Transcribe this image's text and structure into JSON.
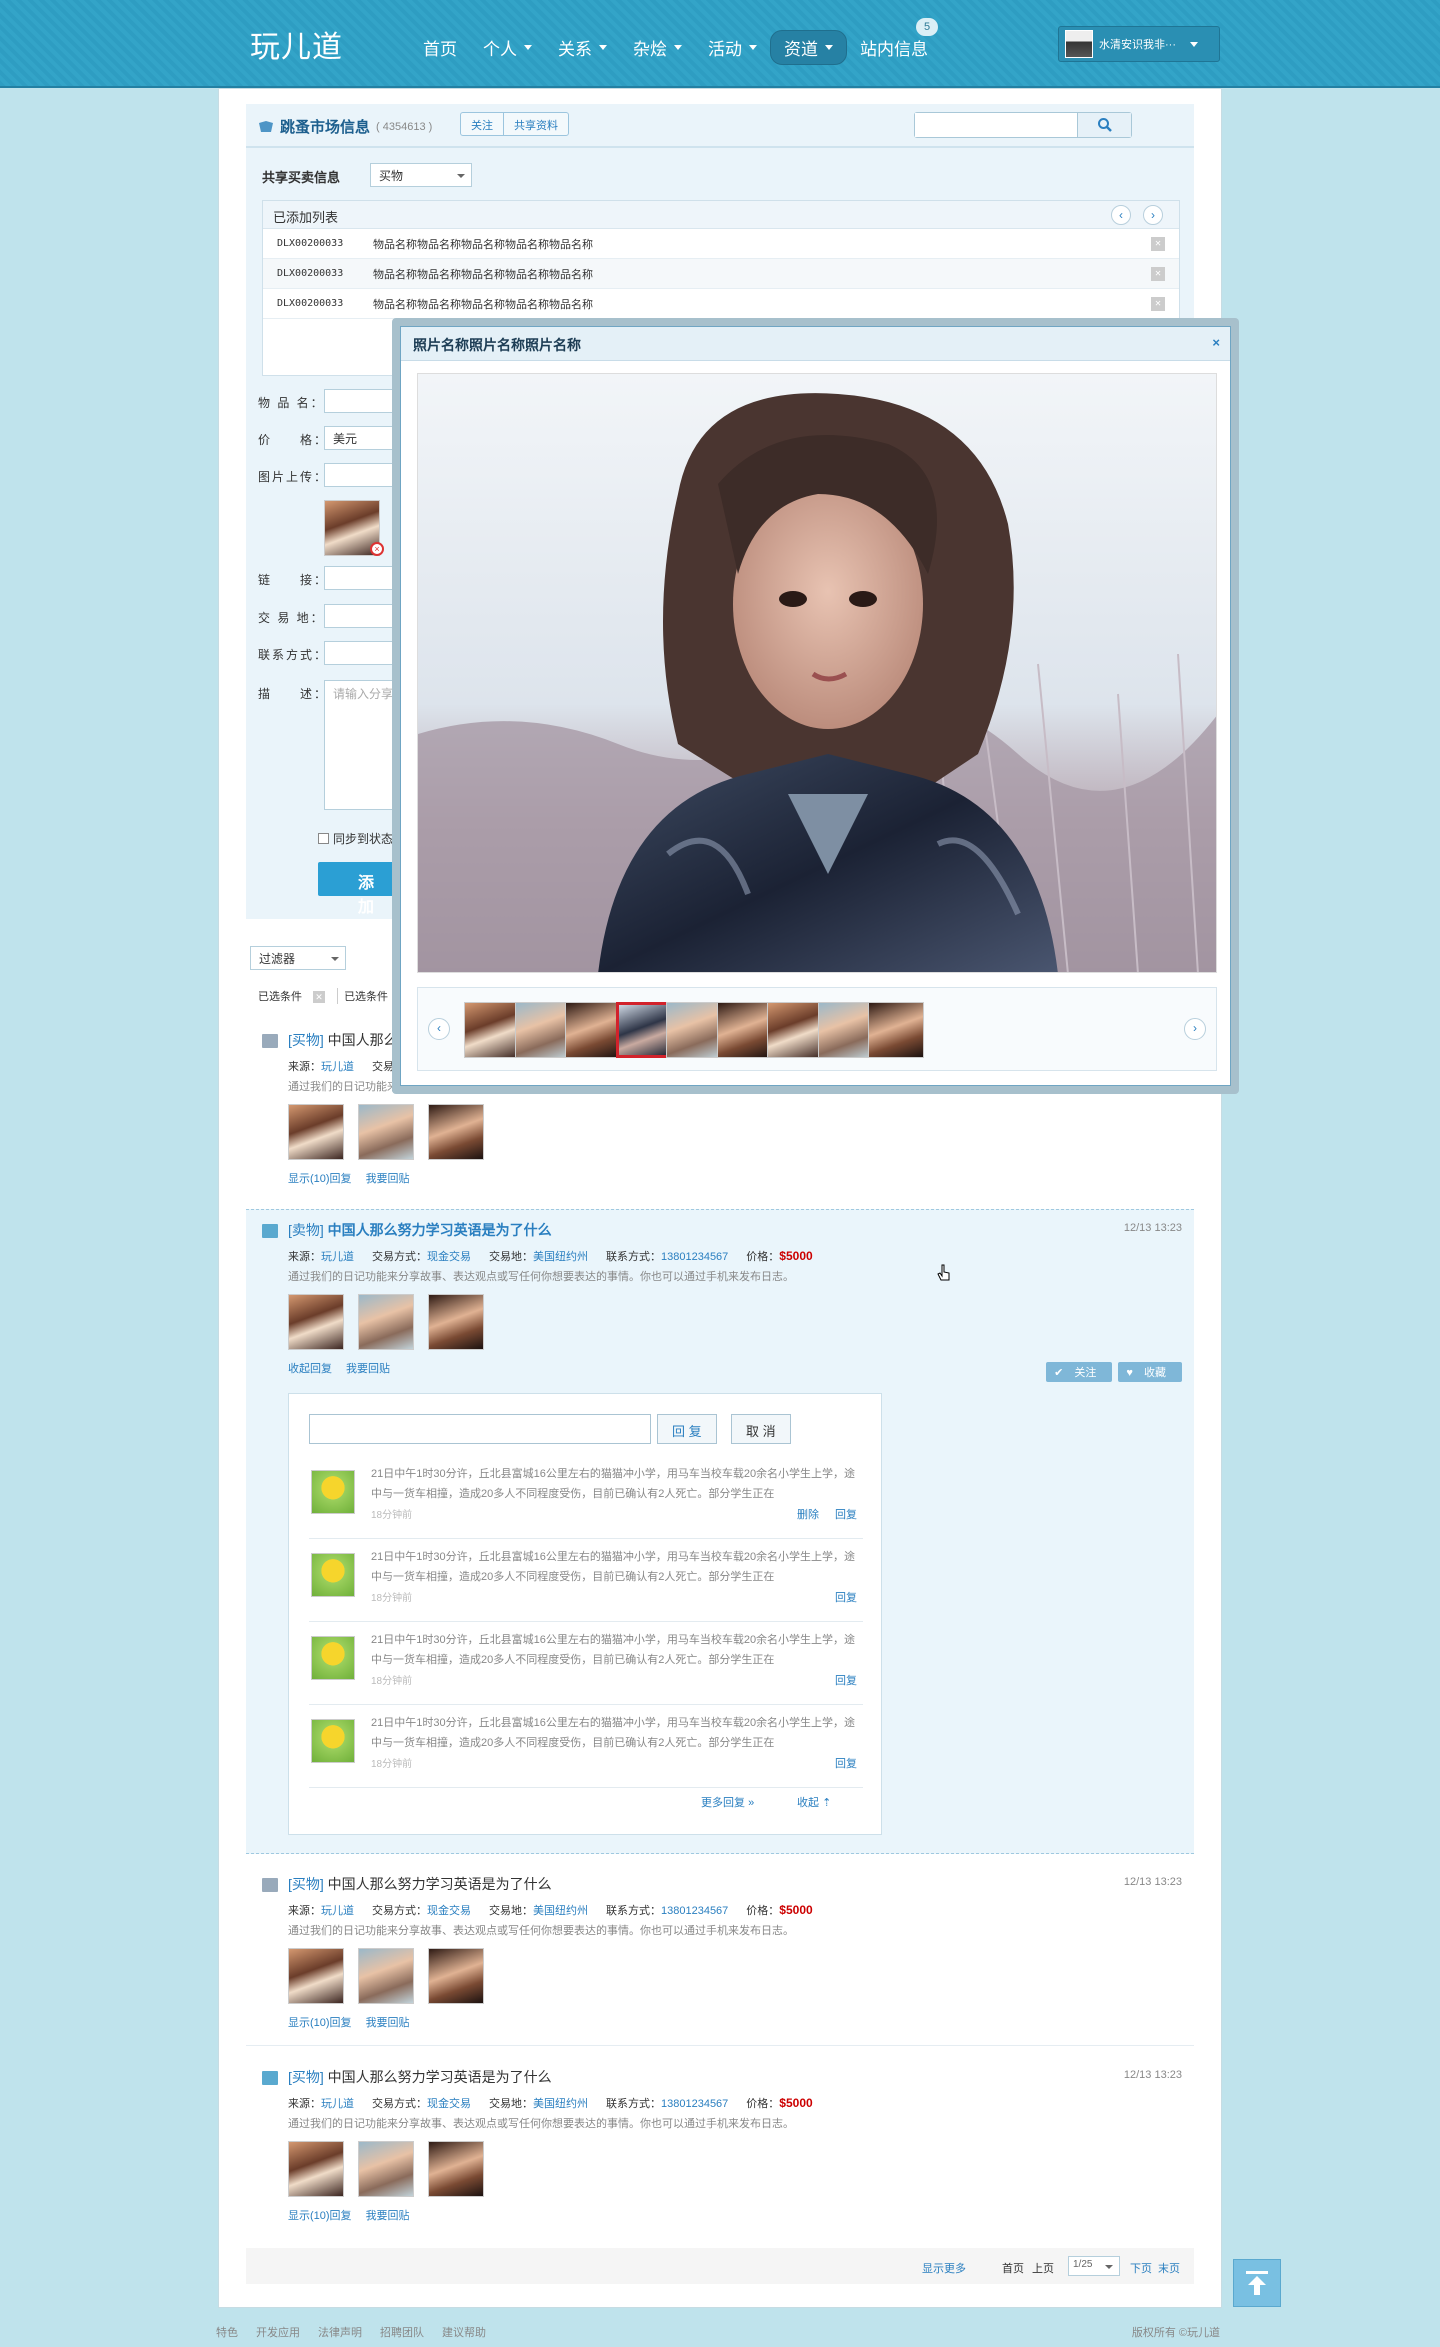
{
  "header": {
    "logo": "玩儿道",
    "nav": [
      {
        "label": "首页",
        "caret": false
      },
      {
        "label": "个人",
        "caret": true
      },
      {
        "label": "关系",
        "caret": true
      },
      {
        "label": "杂烩",
        "caret": true
      },
      {
        "label": "活动",
        "caret": true
      },
      {
        "label": "资道",
        "caret": true
      },
      {
        "label": "站内信息",
        "caret": false
      }
    ],
    "message_count": "5",
    "user_name": "水清安识我非···"
  },
  "group": {
    "title": "跳蚤市场信息",
    "id": "( 4354613 )",
    "follow_label": "关注",
    "share_label": "共享资料",
    "search_placeholder": ""
  },
  "form": {
    "share_label": "共享买卖信息",
    "share_type": "买物",
    "added_list_title": "已添加列表",
    "added_items": [
      {
        "code": "DLX00200033",
        "name": "物品名称物品名称物品名称物品名称物品名称"
      },
      {
        "code": "DLX00200033",
        "name": "物品名称物品名称物品名称物品名称物品名称"
      },
      {
        "code": "DLX00200033",
        "name": "物品名称物品名称物品名称物品名称物品名称"
      }
    ],
    "item_name_label": "物 品 名：",
    "price_label": "价　　格：",
    "price_currency": "美元",
    "image_upload_label": "图片上传：",
    "link_label": "链　　接：",
    "trade_place_label": "交 易 地：",
    "contact_label": "联系方式：",
    "desc_label": "描　　述：",
    "desc_placeholder": "请输入分享",
    "sync_label": "同步到状态",
    "add_button": "添 加"
  },
  "filter": {
    "label": "过滤器",
    "chips": [
      "已选条件",
      "已选条件"
    ]
  },
  "posts": [
    {
      "tag": "[买物]",
      "title": "中国人那么",
      "source_label": "来源：",
      "source": "玩儿道",
      "trade_label": "交易",
      "desc": "通过我们的日记功能来分享故事、表达观点或写任何你想要表达的事情。你也可以通过手机来发布日志。",
      "show_replies": "显示(10)回复",
      "reply_link": "我要回贴"
    },
    {
      "tag": "[卖物]",
      "title": "中国人那么努力学习英语是为了什么",
      "date": "12/13 13:23",
      "source_label": "来源：",
      "source": "玩儿道",
      "trade_label": "交易方式：",
      "trade": "现金交易",
      "place_label": "交易地：",
      "place": "美国纽约州",
      "contact_label": "联系方式：",
      "contact": "13801234567",
      "price_label": "价格：",
      "price": "$5000",
      "desc": "通过我们的日记功能来分享故事、表达观点或写任何你想要表达的事情。你也可以通过手机来发布日志。",
      "collapse_replies": "收起回复",
      "reply_link": "我要回贴",
      "follow_label": "关注",
      "fav_label": "收藏"
    },
    {
      "tag": "[买物]",
      "title": "中国人那么努力学习英语是为了什么",
      "date": "12/13 13:23",
      "source_label": "来源：",
      "source": "玩儿道",
      "trade_label": "交易方式：",
      "trade": "现金交易",
      "place_label": "交易地：",
      "place": "美国纽约州",
      "contact_label": "联系方式：",
      "contact": "13801234567",
      "price_label": "价格：",
      "price": "$5000",
      "desc": "通过我们的日记功能来分享故事、表达观点或写任何你想要表达的事情。你也可以通过手机来发布日志。",
      "show_replies": "显示(10)回复",
      "reply_link": "我要回贴"
    },
    {
      "tag": "[买物]",
      "title": "中国人那么努力学习英语是为了什么",
      "date": "12/13 13:23",
      "source_label": "来源：",
      "source": "玩儿道",
      "trade_label": "交易方式：",
      "trade": "现金交易",
      "place_label": "交易地：",
      "place": "美国纽约州",
      "contact_label": "联系方式：",
      "contact": "13801234567",
      "price_label": "价格：",
      "price": "$5000",
      "desc": "通过我们的日记功能来分享故事、表达观点或写任何你想要表达的事情。你也可以通过手机来发布日志。",
      "show_replies": "显示(10)回复",
      "reply_link": "我要回贴"
    }
  ],
  "replies": {
    "reply_button": "回 复",
    "cancel_button": "取 消",
    "comments": [
      {
        "text": "21日中午1时30分许，丘北县富城16公里左右的猫猫冲小学，用马车当校车载20余名小学生上学，途中与一货车相撞，造成20多人不同程度受伤，目前已确认有2人死亡。部分学生正在",
        "time": "18分钟前",
        "actions": [
          "删除",
          "回复"
        ]
      },
      {
        "text": "21日中午1时30分许，丘北县富城16公里左右的猫猫冲小学，用马车当校车载20余名小学生上学，途中与一货车相撞，造成20多人不同程度受伤，目前已确认有2人死亡。部分学生正在",
        "time": "18分钟前",
        "actions": [
          "回复"
        ]
      },
      {
        "text": "21日中午1时30分许，丘北县富城16公里左右的猫猫冲小学，用马车当校车载20余名小学生上学，途中与一货车相撞，造成20多人不同程度受伤，目前已确认有2人死亡。部分学生正在",
        "time": "18分钟前",
        "actions": [
          "回复"
        ]
      },
      {
        "text": "21日中午1时30分许，丘北县富城16公里左右的猫猫冲小学，用马车当校车载20余名小学生上学，途中与一货车相撞，造成20多人不同程度受伤，目前已确认有2人死亡。部分学生正在",
        "time": "18分钟前",
        "actions": [
          "回复"
        ]
      }
    ],
    "more_replies": "更多回复",
    "collapse": "收起"
  },
  "pager": {
    "show_more": "显示更多",
    "first": "首页",
    "prev": "上页",
    "page": "1/25",
    "next": "下页",
    "last": "末页"
  },
  "footer": {
    "links": [
      "特色",
      "开发应用",
      "法律声明",
      "招聘团队",
      "建议帮助"
    ],
    "copyright": "版权所有 ©玩儿道"
  },
  "modal": {
    "title": "照片名称照片名称照片名称",
    "close": "×",
    "thumb_count": 9,
    "selected_index": 3
  },
  "colors": {
    "header_bg": "#2e9dc2",
    "page_bg": "#bfe3ec",
    "link": "#2a7fc0",
    "price": "#cc0000",
    "selected_border": "#d2222b",
    "primary_button": "#2b9fd4"
  }
}
